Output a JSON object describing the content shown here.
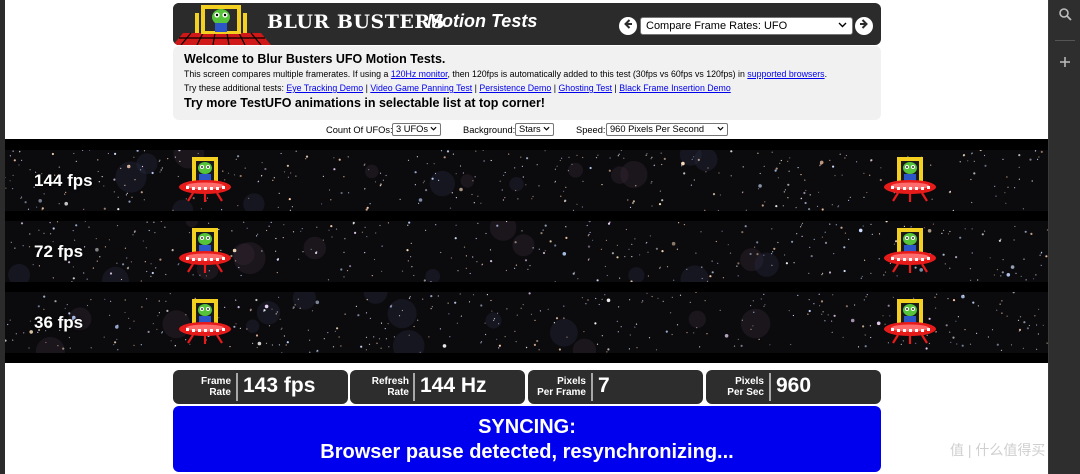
{
  "header": {
    "title": "BLUR BUSTERS",
    "subtitle": "Motion Tests",
    "test_select": {
      "value": "Compare Frame Rates: UFO"
    }
  },
  "welcome": {
    "heading": "Welcome to Blur Busters UFO Motion Tests.",
    "line1_pre": "This screen compares multiple framerates. If using a ",
    "line1_link1": "120Hz monitor",
    "line1_mid": ", then 120fps is automatically added to this test (30fps vs 60fps vs 120fps) in ",
    "line1_link2": "supported browsers",
    "line1_post": ".",
    "tests_label": "Try these additional tests: ",
    "links": [
      "Eye Tracking Demo",
      "Video Game Panning Test",
      "Persistence Demo",
      "Ghosting Test",
      "Black Frame Insertion Demo"
    ],
    "link_separator": " | ",
    "promo": "Try more TestUFO animations in selectable list at top corner!"
  },
  "options": {
    "count_label": "Count Of UFOs:",
    "count_value": "3 UFOs",
    "background_label": "Background:",
    "background_value": "Stars",
    "speed_label": "Speed:",
    "speed_value": "960 Pixels Per Second"
  },
  "lanes": [
    {
      "label": "144 fps"
    },
    {
      "label": "72 fps"
    },
    {
      "label": "36 fps"
    }
  ],
  "stats": {
    "frame_rate": {
      "label1": "Frame",
      "label2": "Rate",
      "value": "143 fps"
    },
    "refresh_rate": {
      "label1": "Refresh",
      "label2": "Rate",
      "value": "144 Hz"
    },
    "pixels_per_frame": {
      "label1": "Pixels",
      "label2": "Per Frame",
      "value": "7"
    },
    "pixels_per_sec": {
      "label1": "Pixels",
      "label2": "Per Sec",
      "value": "960"
    }
  },
  "sync": {
    "title": "SYNCING:",
    "message": "Browser pause detected, resynchronizing..."
  },
  "watermark": "值 | 什么值得买",
  "colors": {
    "header_bg": "#2b2b2b",
    "panel_bg": "#f1f1f1",
    "link": "#0000ee",
    "sync_bg": "#0000ee",
    "stat_bg": "#2d2d2d"
  },
  "icons": {
    "prev": "arrow-left-circle-icon",
    "next": "arrow-right-circle-icon",
    "sidebar_search": "search-icon",
    "sidebar_add": "plus-icon"
  }
}
